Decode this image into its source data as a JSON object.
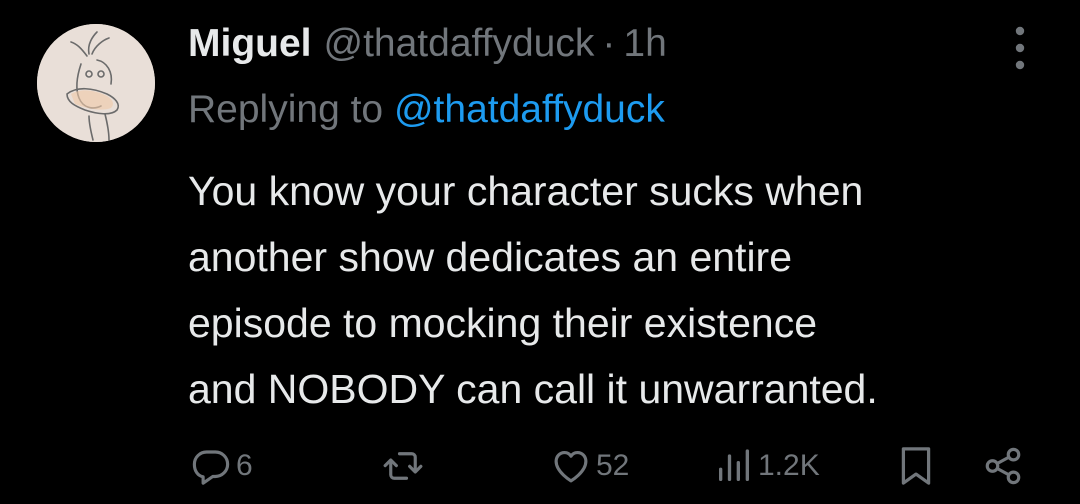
{
  "author": {
    "name": "Miguel",
    "handle": "@thatdaffyduck",
    "separator": "·",
    "time": "1h"
  },
  "reply": {
    "prefix": "Replying to",
    "mention": "@thatdaffyduck"
  },
  "tweet": {
    "lines": [
      "You know your character sucks when",
      "another show dedicates an entire",
      "episode to mocking their existence",
      "and NOBODY can call it unwarranted."
    ]
  },
  "actions": {
    "replies": "6",
    "retweets": "",
    "likes": "52",
    "views": "1.2K"
  },
  "colors": {
    "background": "#000000",
    "primary_text": "#e7e9ea",
    "secondary_text": "#71767b",
    "accent": "#1d9bf0"
  },
  "icons": [
    "more-icon",
    "reply-icon",
    "retweet-icon",
    "like-icon",
    "views-icon",
    "bookmark-icon",
    "share-icon"
  ]
}
